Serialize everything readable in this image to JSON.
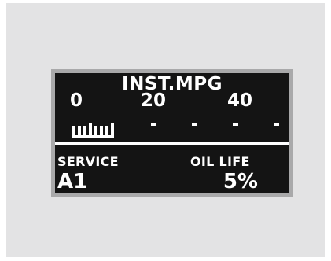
{
  "display": {
    "title": "INST.MPG",
    "scale": {
      "labels": [
        "0",
        "20",
        "40"
      ],
      "fill_fraction": 0.2
    },
    "service": {
      "label": "SERVICE",
      "code": "A1"
    },
    "oil_life": {
      "label": "OIL LIFE",
      "value": "5%"
    }
  },
  "colors": {
    "panel_bg": "#e3e3e4",
    "frame": "#a9a9aa",
    "lcd_bg": "#141414",
    "lcd_fg": "#ffffff"
  }
}
